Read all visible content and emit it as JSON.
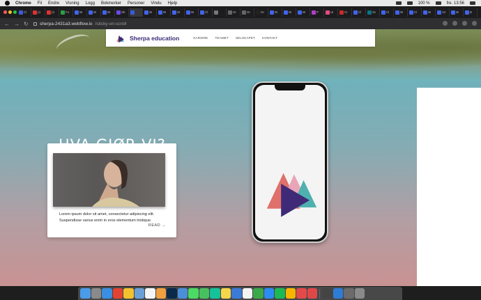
{
  "menubar": {
    "app_name": "Chrome",
    "menus": [
      "Fil",
      "Endre",
      "Visning",
      "Logg",
      "Bokmerker",
      "Personer",
      "Vindu",
      "Hjelp"
    ],
    "battery": "100 %",
    "clock": "fre. 13:56"
  },
  "tabs": [
    {
      "label": "Cl",
      "color": "#3b5bdb"
    },
    {
      "label": "(4",
      "color": "#e03131"
    },
    {
      "label": "(4",
      "color": "#e03131"
    },
    {
      "label": "Fo",
      "color": "#2f9e44"
    },
    {
      "label": "W",
      "color": "#4263eb"
    },
    {
      "label": "W",
      "color": "#4263eb"
    },
    {
      "label": "W",
      "color": "#4263eb"
    },
    {
      "label": "Sh",
      "color": "#7048e8"
    },
    {
      "label": "",
      "color": "#3b5bdb",
      "active": true
    },
    {
      "label": "W",
      "color": "#4263eb"
    },
    {
      "label": "W",
      "color": "#4263eb"
    },
    {
      "label": "St",
      "color": "#4263eb"
    },
    {
      "label": "W",
      "color": "#4263eb"
    },
    {
      "label": "Cl",
      "color": "#4263eb"
    },
    {
      "label": "",
      "color": "#777"
    },
    {
      "label": "Gr",
      "color": "#666"
    },
    {
      "label": "Gr",
      "color": "#666"
    },
    {
      "label": "Gr",
      "color": "#222"
    },
    {
      "label": "W",
      "color": "#4263eb"
    },
    {
      "label": "W",
      "color": "#4263eb"
    },
    {
      "label": "W",
      "color": "#4263eb"
    },
    {
      "label": "P",
      "color": "#ae3ec9"
    },
    {
      "label": "Ui",
      "color": "#e64980"
    },
    {
      "label": "Cr",
      "color": "#c92a2a"
    },
    {
      "label": "Cl",
      "color": "#4263eb"
    },
    {
      "label": "Sc",
      "color": "#0b7285"
    },
    {
      "label": "Cl",
      "color": "#4263eb"
    },
    {
      "label": "W",
      "color": "#4263eb"
    },
    {
      "label": "Cl",
      "color": "#4263eb"
    },
    {
      "label": "W",
      "color": "#4263eb"
    },
    {
      "label": "1C",
      "color": "#4263eb"
    },
    {
      "label": "W",
      "color": "#4263eb"
    },
    {
      "label": "D",
      "color": "#4263eb"
    }
  ],
  "address": {
    "host": "sherpa-2431a3.webflow.io",
    "path": "/sticky-on-scroll"
  },
  "site": {
    "brand": "Sherpa education",
    "nav": [
      "KARIERE",
      "TEAMET",
      "SELSKAPET",
      "KONTAKT"
    ],
    "social_icons": [
      "facebook-icon",
      "twitter-icon",
      "instagram-icon"
    ],
    "heading": "HVA GJØR VI?",
    "card_text": "Lorem ipsum dolor sit amet, consectetur adipiscing elit. Suspendisse varius enim in eros elementum tristique.",
    "card_link": "READ →"
  },
  "colors": {
    "brand_purple": "#3f2a78",
    "logo_red": "#e0706a",
    "logo_pink": "#e8a0b4",
    "logo_teal": "#4fb0b0"
  },
  "dock": [
    {
      "name": "finder-icon",
      "color": "#4a9be8"
    },
    {
      "name": "launchpad-icon",
      "color": "#8a8a8a"
    },
    {
      "name": "safari-icon",
      "color": "#3a8fe0"
    },
    {
      "name": "todoist-icon",
      "color": "#e44232"
    },
    {
      "name": "chrome-icon",
      "color": "#f2c12e"
    },
    {
      "name": "preview-icon",
      "color": "#6aa0d8"
    },
    {
      "name": "calendar-icon",
      "color": "#f5f5f5"
    },
    {
      "name": "photos-icon",
      "color": "#f0a040"
    },
    {
      "name": "photoshop-icon",
      "color": "#0a2a4a"
    },
    {
      "name": "folder-icon",
      "color": "#4a8fd8"
    },
    {
      "name": "messages-icon",
      "color": "#4cd964"
    },
    {
      "name": "facetime-icon",
      "color": "#49c060"
    },
    {
      "name": "grammarly-icon",
      "color": "#15c39a"
    },
    {
      "name": "notes-icon",
      "color": "#f5d54a"
    },
    {
      "name": "keynote-icon",
      "color": "#3b7bd8"
    },
    {
      "name": "itunes-icon",
      "color": "#f4f4f4"
    },
    {
      "name": "numbers-icon",
      "color": "#3aa94a"
    },
    {
      "name": "app-store-icon",
      "color": "#2d8cf0"
    },
    {
      "name": "spotify-icon",
      "color": "#1db954"
    },
    {
      "name": "sketch-icon",
      "color": "#f7b500"
    },
    {
      "name": "pdf-icon",
      "color": "#e34a4a"
    },
    {
      "name": "sherpa-icon",
      "color": "#e04848"
    },
    {
      "name": "instruments-icon",
      "color": "#444"
    },
    {
      "name": "vscode-icon",
      "color": "#2d7cd6"
    },
    {
      "name": "downloads-icon",
      "color": "#6b6b6b"
    },
    {
      "name": "trash-icon",
      "color": "#8a8a8a"
    }
  ]
}
